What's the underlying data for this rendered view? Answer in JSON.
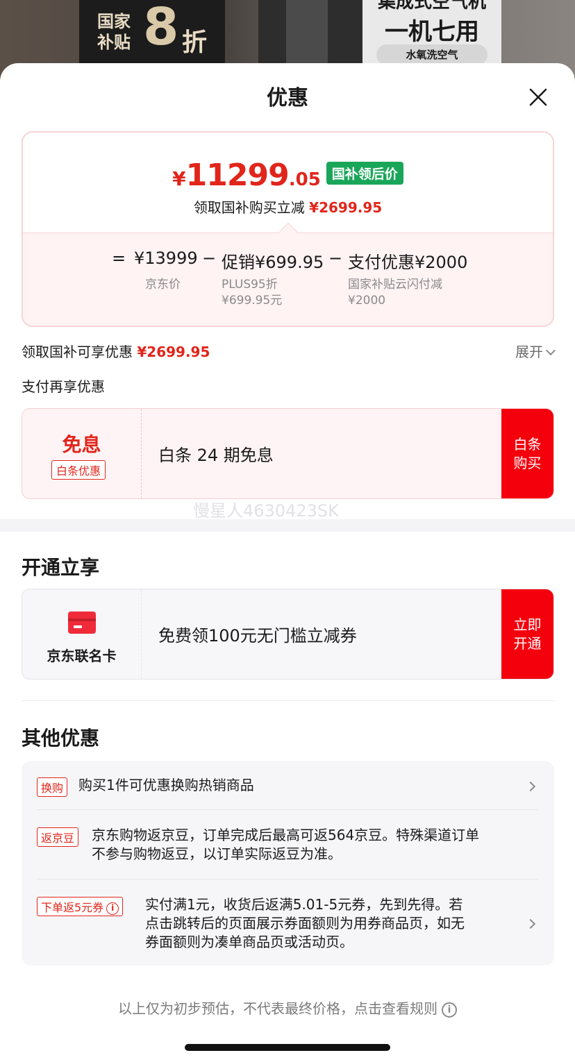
{
  "background": {
    "left_tag": "国家补贴",
    "left_big": "8",
    "left_unit": "折",
    "right_line1": "集成式空气机",
    "right_line2": "一机七用",
    "right_pill": "水氧洗空气"
  },
  "sheet": {
    "title": "优惠",
    "close_icon": "close-icon"
  },
  "price_card": {
    "currency": "¥",
    "price_int": "11299",
    "price_dec": ".05",
    "badge": "国补领后价",
    "sub_label": "领取国补购买立减",
    "sub_value": "¥2699.95",
    "eq": "=",
    "base_price": "¥13999",
    "minus1": "−",
    "promo_label": "促销¥699.95",
    "minus2": "−",
    "pay_label": "支付优惠¥2000",
    "base_desc": "京东价",
    "promo_desc1": "PLUS95折",
    "promo_desc2": "¥699.95元",
    "pay_desc1": "国家补贴云闪付减",
    "pay_desc2": "¥2000"
  },
  "subsidy_row": {
    "label": "领取国补可享优惠",
    "value": "¥2699.95",
    "expand": "展开"
  },
  "pay_section": {
    "title": "支付再享优惠",
    "left_title": "免息",
    "left_tag": "白条优惠",
    "middle": "白条 24 期免息",
    "button": "白条\n购买",
    "button_l1": "白条",
    "button_l2": "购买"
  },
  "watermark": "慢星人4630423SK",
  "open_section": {
    "title": "开通立享",
    "card_name": "京东联名卡",
    "middle": "免费领100元无门槛立减券",
    "button_l1": "立即",
    "button_l2": "开通"
  },
  "other_section": {
    "title": "其他优惠",
    "items": [
      {
        "tag": "换购",
        "text": "购买1件可优惠换购热销商品"
      },
      {
        "tag": "返京豆",
        "text_l1": "京东购物返京豆，订单完成后最高可返564京豆。特殊渠道订单",
        "text_l2": "不参与购物返豆，以订单实际返豆为准。"
      },
      {
        "tag": "下单返5元券",
        "text_l1": "实付满1元，收货后返满5.01-5元券，先到先得。若",
        "text_l2": "点击跳转后的页面展示券面额则为用券商品页，如无",
        "text_l3": "券面额则为凑单商品页或活动页。"
      }
    ]
  },
  "footer": {
    "note": "以上仅为初步预估，不代表最终价格，点击查看规则",
    "info_icon": "i"
  },
  "colors": {
    "accent_red": "#e1251b",
    "button_red": "#f4000d",
    "badge_green": "#19a659"
  }
}
